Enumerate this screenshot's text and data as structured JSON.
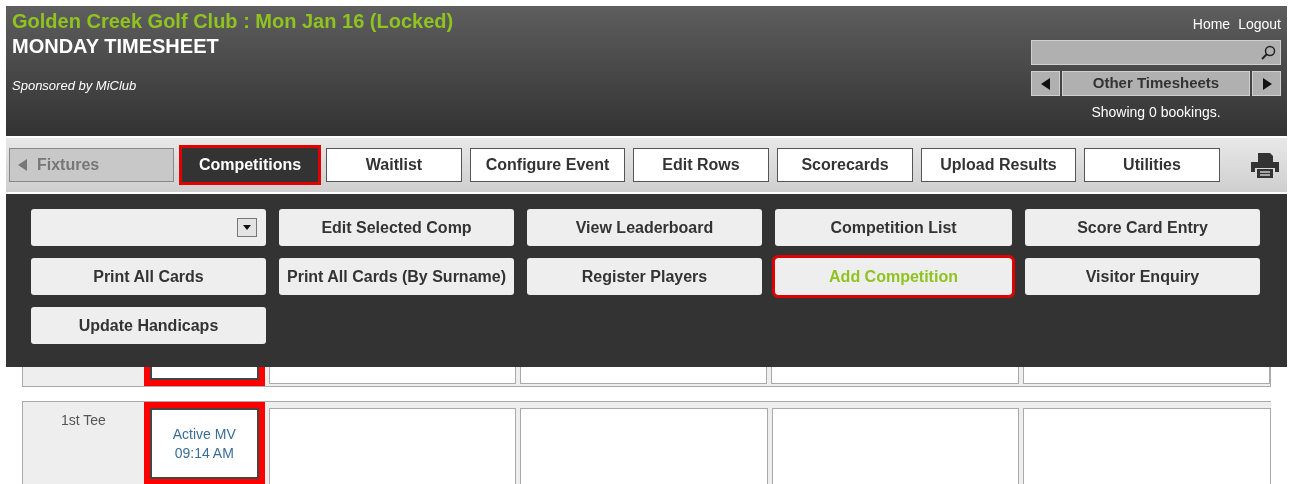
{
  "header": {
    "title": "Golden Creek Golf Club : Mon Jan 16 (Locked)",
    "subtitle": "MONDAY TIMESHEET",
    "sponsor": "Sponsored by MiClub",
    "links": [
      "Home",
      "Logout"
    ],
    "timesheets": "Other Timesheets",
    "status": "Showing 0 bookings."
  },
  "tabs": [
    {
      "label": "Fixtures",
      "kind": "back",
      "selected": false,
      "highlighted": false
    },
    {
      "label": "Competitions",
      "kind": "tab",
      "selected": true,
      "highlighted": true
    },
    {
      "label": "Waitlist",
      "kind": "tab",
      "selected": false,
      "highlighted": false
    },
    {
      "label": "Configure Event",
      "kind": "tab",
      "selected": false,
      "highlighted": false
    },
    {
      "label": "Edit Rows",
      "kind": "tab",
      "selected": false,
      "highlighted": false
    },
    {
      "label": "Scorecards",
      "kind": "tab",
      "selected": false,
      "highlighted": false
    },
    {
      "label": "Upload Results",
      "kind": "tab",
      "selected": false,
      "highlighted": false
    },
    {
      "label": "Utilities",
      "kind": "tab",
      "selected": false,
      "highlighted": false
    }
  ],
  "menu": [
    {
      "kind": "select"
    },
    {
      "kind": "button",
      "label": "Edit Selected Comp",
      "highlighted": false
    },
    {
      "kind": "button",
      "label": "View Leaderboard",
      "highlighted": false
    },
    {
      "kind": "button",
      "label": "Competition List",
      "highlighted": false
    },
    {
      "kind": "button",
      "label": "Score Card Entry",
      "highlighted": false
    },
    {
      "kind": "button",
      "label": "Print All Cards",
      "highlighted": false
    },
    {
      "kind": "button",
      "label": "Print All Cards (By Surname)",
      "highlighted": false
    },
    {
      "kind": "button",
      "label": "Register Players",
      "highlighted": false
    },
    {
      "kind": "button",
      "label": "Add Competition",
      "highlighted": true
    },
    {
      "kind": "button",
      "label": "Visitor Enquiry",
      "highlighted": false
    },
    {
      "kind": "button",
      "label": "Update Handicaps",
      "highlighted": false
    }
  ],
  "rows": [
    {
      "slot": {
        "highlighted": true
      }
    },
    {
      "label": "1st Tee",
      "slot": {
        "highlighted": true,
        "lines": [
          "Active MV",
          "09:14 AM"
        ]
      }
    }
  ]
}
